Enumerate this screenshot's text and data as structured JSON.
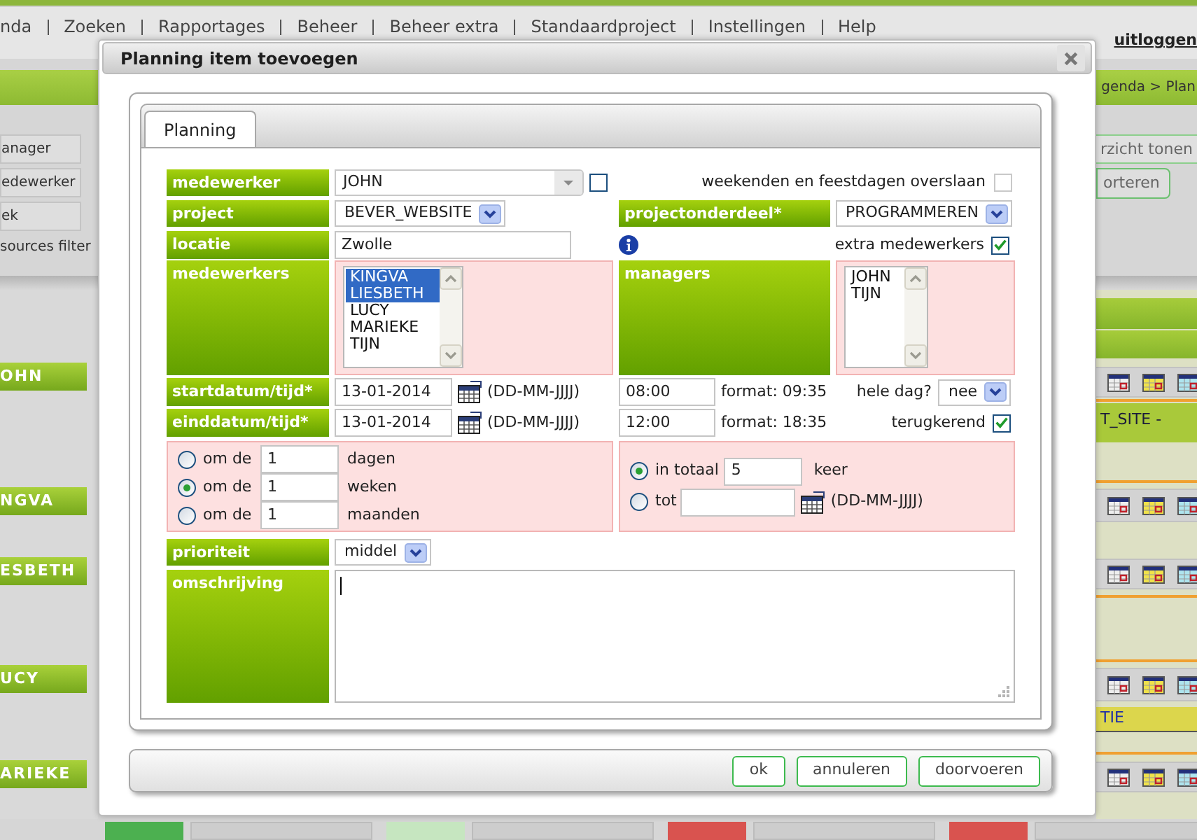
{
  "menu": {
    "items": [
      "nda",
      "Zoeken",
      "Rapportages",
      "Beheer",
      "Beheer extra",
      "Standaardproject",
      "Instellingen",
      "Help"
    ],
    "logout": "uitloggen"
  },
  "breadcrumb": "genda > Plan",
  "filters": {
    "labels": [
      {
        "kind": "box",
        "text": "anager"
      },
      {
        "kind": "box",
        "text": "edewerker"
      },
      {
        "kind": "box",
        "text": "ek"
      },
      {
        "kind": "plain",
        "text": "sources filter"
      }
    ],
    "overview_button": "rzicht tonen",
    "sort_button": "orteren"
  },
  "employees": [
    "OHN",
    "NGVA",
    "ESBETH",
    "UCY",
    "ARIEKE"
  ],
  "schedule": {
    "entries": [
      {
        "text": "T_SITE -",
        "color": "#a9c93a"
      },
      {
        "text": "TIE",
        "color": "#dcd64c"
      }
    ],
    "blocks": [
      {
        "color": "#4cb050"
      },
      {
        "color": "#c6e6c0"
      },
      {
        "color": "#d9534f"
      },
      {
        "color": "#d9534f"
      }
    ]
  },
  "dialog": {
    "title": "Planning item toevoegen",
    "tabs": [
      {
        "label": "Planning",
        "selected": true
      }
    ],
    "medewerker": {
      "label": "medewerker",
      "value": "JOHN",
      "checked": false
    },
    "skip_weekends": {
      "label": "weekenden en feestdagen overslaan",
      "checked": false,
      "disabled": true
    },
    "project": {
      "label": "project",
      "value": "BEVER_WEBSITE"
    },
    "project_part": {
      "label": "projectonderdeel*",
      "value": "PROGRAMMEREN"
    },
    "location": {
      "label": "locatie",
      "value": "Zwolle"
    },
    "extra_employees": {
      "label": "extra medewerkers",
      "checked": true
    },
    "employees": {
      "label": "medewerkers",
      "options": [
        {
          "text": "KINGVA",
          "selected": true
        },
        {
          "text": "LIESBETH",
          "selected": true
        },
        {
          "text": "LUCY",
          "selected": false
        },
        {
          "text": "MARIEKE",
          "selected": false
        },
        {
          "text": "TIJN",
          "selected": false
        }
      ]
    },
    "managers": {
      "label": "managers",
      "options": [
        {
          "text": "JOHN",
          "selected": false
        },
        {
          "text": "TIJN",
          "selected": false
        }
      ]
    },
    "start": {
      "label": "startdatum/tijd*",
      "date": "13-01-2014",
      "date_hint": "(DD-MM-JJJJ)",
      "time": "08:00",
      "time_hint": "format: 09:35"
    },
    "end": {
      "label": "einddatum/tijd*",
      "date": "13-01-2014",
      "date_hint": "(DD-MM-JJJJ)",
      "time": "12:00",
      "time_hint": "format: 18:35"
    },
    "all_day": {
      "label": "hele dag?",
      "value": "nee"
    },
    "recurring": {
      "label": "terugkerend",
      "checked": true
    },
    "interval": [
      {
        "label": "om de",
        "value": "1",
        "unit": "dagen",
        "selected": false
      },
      {
        "label": "om de",
        "value": "1",
        "unit": "weken",
        "selected": true
      },
      {
        "label": "om de",
        "value": "1",
        "unit": "maanden",
        "selected": false
      }
    ],
    "end_rule": [
      {
        "kind": "count",
        "label": "in totaal",
        "value": "5",
        "unit": "keer",
        "selected": true
      },
      {
        "kind": "until",
        "label": "tot",
        "hint": "(DD-MM-JJJJ)",
        "selected": false
      }
    ],
    "priority": {
      "label": "prioriteit",
      "value": "middel"
    },
    "description": {
      "label": "omschrijving",
      "focused": true
    },
    "buttons": [
      "ok",
      "annuleren",
      "doorvoeren"
    ]
  }
}
